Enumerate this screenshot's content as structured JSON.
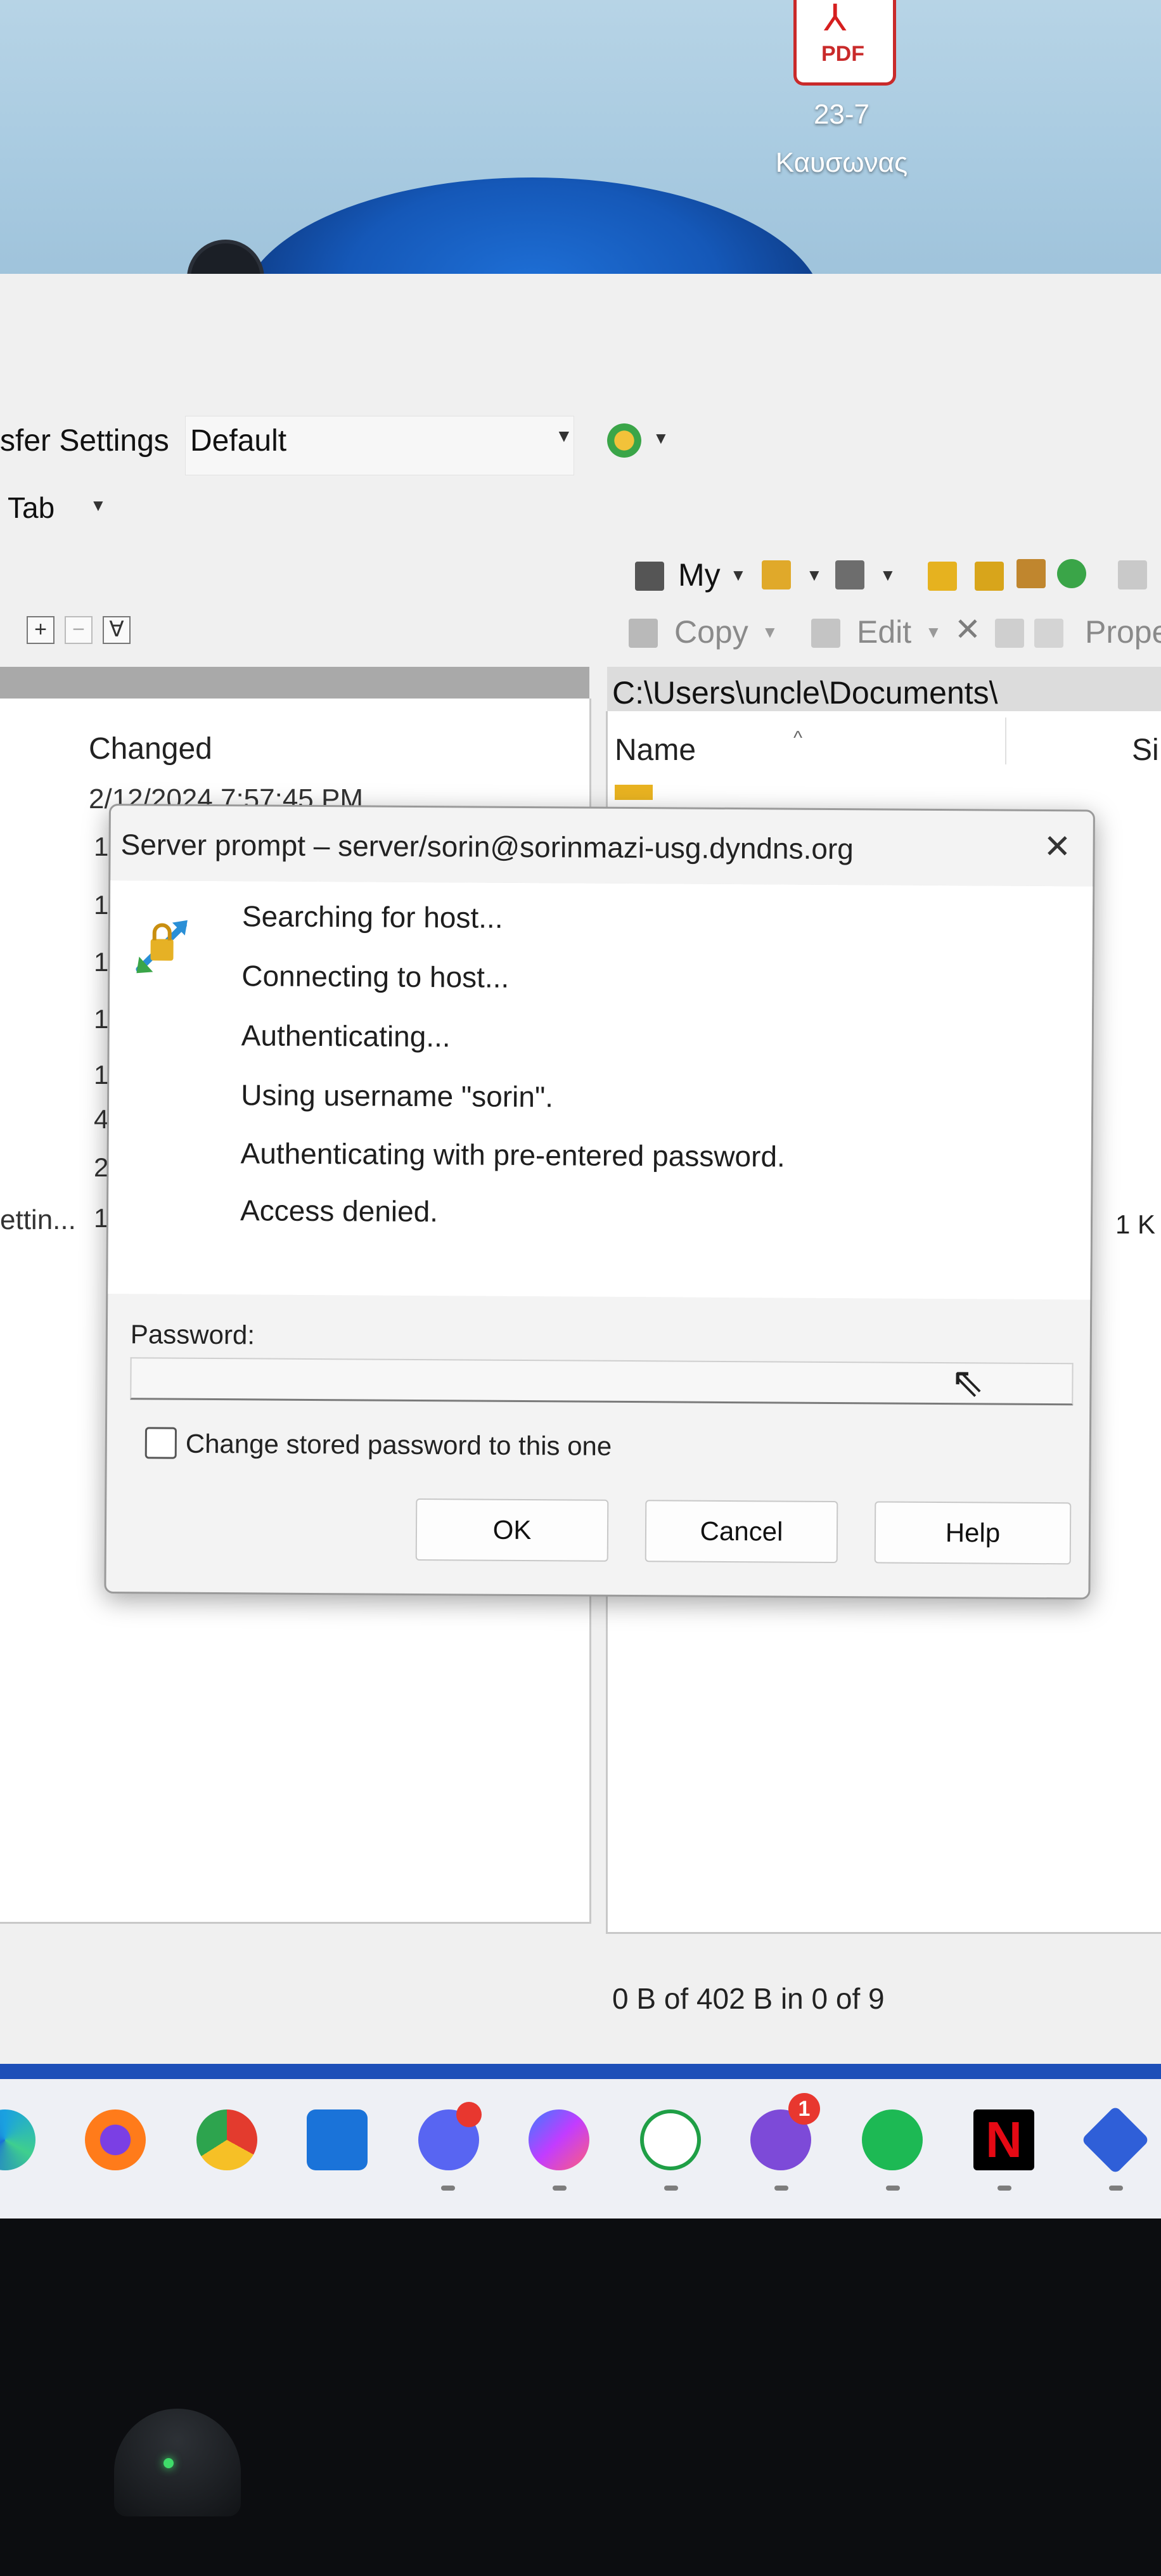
{
  "desktop": {
    "pdf_badge": "PDF",
    "icon_caption_line1": "23-7",
    "icon_caption_line2": "Καυσωνας"
  },
  "app": {
    "transfer_settings_label": "sfer Settings",
    "transfer_settings_value": "Default",
    "tab_label": "Tab",
    "toolbar": {
      "my_label": "My",
      "copy_label": "Copy",
      "edit_label": "Edit",
      "properties_label": "Prope"
    },
    "left_panel": {
      "column_changed": "Changed",
      "partial_row": "2/12/2024 7:57:45 PM",
      "partial_setting": "ettin...",
      "row_digits": [
        "1",
        "1",
        "1",
        "1",
        "1",
        "4",
        "2",
        "1"
      ]
    },
    "right_panel": {
      "path": "C:\\Users\\uncle\\Documents\\",
      "column_name": "Name",
      "column_size": "Si",
      "size_value": "1 K",
      "status": "0 B of 402 B in 0 of 9"
    }
  },
  "dialog": {
    "title": "Server prompt – server/sorin@sorinmazi-usg.dyndns.org",
    "messages": [
      "Searching for host...",
      "Connecting to host...",
      "Authenticating...",
      "Using username \"sorin\".",
      "Authenticating with pre-entered password.",
      "Access denied."
    ],
    "password_label": "Password:",
    "password_value": "",
    "checkbox_label": "Change stored password to this one",
    "checkbox_checked": false,
    "ok_label": "OK",
    "cancel_label": "Cancel",
    "help_label": "Help"
  },
  "taskbar": {
    "apps": [
      "edge-icon",
      "firefox-icon",
      "chrome-icon",
      "store-icon",
      "discord-icon",
      "messenger-icon",
      "whatsapp-icon",
      "viber-icon",
      "spotify-icon",
      "netflix-icon",
      "media-player-icon"
    ],
    "viber_badge": "1",
    "netflix_letter": "N"
  },
  "colors": {
    "taskbar_accent": "#1d4fb8",
    "badge_red": "#e8372f",
    "dialog_bg": "#f3f3f3"
  }
}
